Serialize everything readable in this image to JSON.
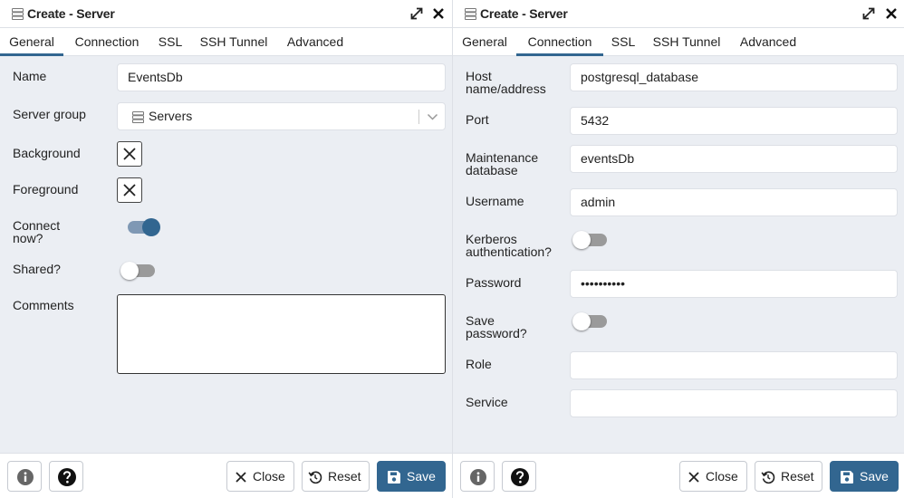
{
  "colors": {
    "accent": "#326690",
    "form_bg": "#ebeef3",
    "border": "#dde0e6"
  },
  "left": {
    "title": "Create - Server",
    "tabs": [
      {
        "label": "General",
        "active": true
      },
      {
        "label": "Connection",
        "active": false
      },
      {
        "label": "SSL",
        "active": false
      },
      {
        "label": "SSH Tunnel",
        "active": false
      },
      {
        "label": "Advanced",
        "active": false
      }
    ],
    "name_label": "Name",
    "name_value": "EventsDb",
    "server_group_label": "Server group",
    "server_group_value": "Servers",
    "background_label": "Background",
    "foreground_label": "Foreground",
    "connect_now_label_1": "Connect",
    "connect_now_label_2": "now?",
    "connect_now": true,
    "shared_label": "Shared?",
    "shared": false,
    "comments_label": "Comments",
    "comments_value": ""
  },
  "right": {
    "title": "Create - Server",
    "tabs": [
      {
        "label": "General",
        "active": false
      },
      {
        "label": "Connection",
        "active": true
      },
      {
        "label": "SSL",
        "active": false
      },
      {
        "label": "SSH Tunnel",
        "active": false
      },
      {
        "label": "Advanced",
        "active": false
      }
    ],
    "host_label_1": "Host",
    "host_label_2": "name/address",
    "host_value": "postgresql_database",
    "port_label": "Port",
    "port_value": "5432",
    "maint_label_1": "Maintenance",
    "maint_label_2": "database",
    "maint_value": "eventsDb",
    "username_label": "Username",
    "username_value": "admin",
    "kerberos_label_1": "Kerberos",
    "kerberos_label_2": "authentication?",
    "kerberos": false,
    "password_label": "Password",
    "password_value": "••••••••••",
    "save_password_label_1": "Save",
    "save_password_label_2": "password?",
    "save_password": false,
    "role_label": "Role",
    "role_value": "",
    "service_label": "Service",
    "service_value": ""
  },
  "footer": {
    "close_label": "Close",
    "reset_label": "Reset",
    "save_label": "Save"
  },
  "icons": {
    "server": "server-icon",
    "expand": "expand-icon",
    "close": "close-icon",
    "info": "info-icon",
    "help": "help-icon",
    "reset": "reset-icon",
    "save": "floppy-icon",
    "chevron": "chevron-down-icon"
  }
}
